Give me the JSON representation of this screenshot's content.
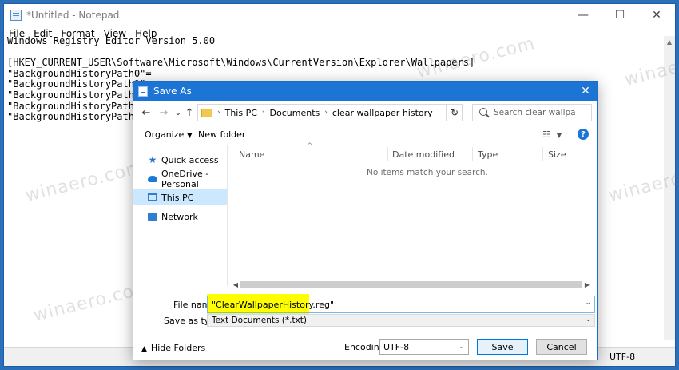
{
  "notepad": {
    "title": "*Untitled - Notepad",
    "window_controls": {
      "minimize": "—",
      "maximize": "☐",
      "close": "✕"
    },
    "menu": [
      "File",
      "Edit",
      "Format",
      "View",
      "Help"
    ],
    "content_lines": [
      "Windows Registry Editor Version 5.00",
      "",
      "[HKEY_CURRENT_USER\\Software\\Microsoft\\Windows\\CurrentVersion\\Explorer\\Wallpapers]",
      "\"BackgroundHistoryPath0\"=-",
      "\"BackgroundHistoryPath1\"=-",
      "\"BackgroundHistoryPath2\"=-",
      "\"BackgroundHistoryPath3\"=-",
      "\"BackgroundHistoryPath4\"=-"
    ],
    "status": {
      "encoding": "UTF-8"
    }
  },
  "dialog": {
    "title": "Save As",
    "close_glyph": "✕",
    "nav": {
      "back": "←",
      "forward": "→",
      "dropdown": "⌄",
      "up": "↑",
      "refresh": "↻"
    },
    "breadcrumb": [
      "This PC",
      "Documents",
      "clear wallpaper history"
    ],
    "breadcrumb_sep": "›",
    "search": {
      "placeholder": "Search clear wallpaper history"
    },
    "toolbar": {
      "organize": "Organize",
      "new_folder": "New folder",
      "view_icon": "☷",
      "help": "?"
    },
    "nav_pane": [
      {
        "label": "Quick access",
        "icon": "star-icon"
      },
      {
        "label": "OneDrive - Personal",
        "icon": "cloud-icon"
      },
      {
        "label": "This PC",
        "icon": "computer-icon",
        "selected": true
      },
      {
        "label": "Network",
        "icon": "network-icon"
      }
    ],
    "columns": [
      "Name",
      "Date modified",
      "Type",
      "Size"
    ],
    "empty_message": "No items match your search.",
    "file_name_label": "File name:",
    "file_name_value": "\"ClearWallpaperHistory.reg\"",
    "save_as_type_label": "Save as type:",
    "save_as_type_value": "Text Documents (*.txt)",
    "hide_folders": "Hide Folders",
    "encoding_label": "Encoding:",
    "encoding_value": "UTF-8",
    "save_button": "Save",
    "cancel_button": "Cancel",
    "highlight_color": "#ffff00",
    "accent_color": "#1c74d4"
  },
  "watermark": "winaero.com"
}
